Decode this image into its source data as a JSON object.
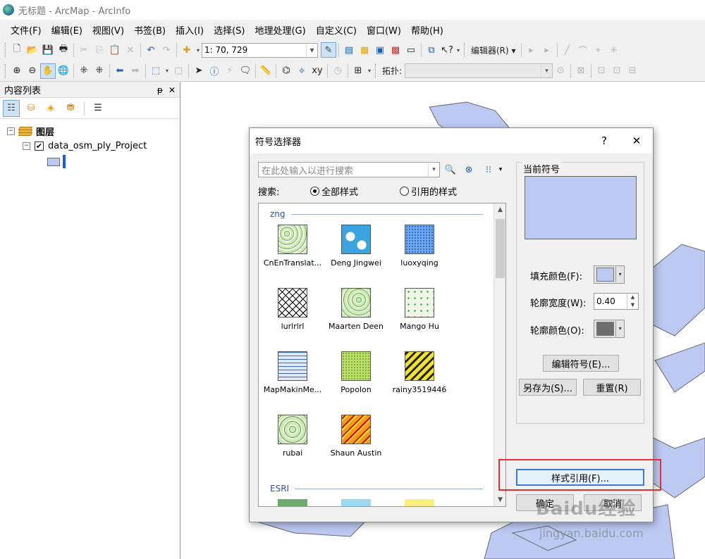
{
  "window": {
    "title": "无标题 - ArcMap - ArcInfo"
  },
  "menu": [
    "文件(F)",
    "编辑(E)",
    "视图(V)",
    "书签(B)",
    "插入(I)",
    "选择(S)",
    "地理处理(G)",
    "自定义(C)",
    "窗口(W)",
    "帮助(H)"
  ],
  "toolbar": {
    "scale": "1: 70, 729",
    "editor_label": "编辑器(R) ▾",
    "topology_label": "拓扑:"
  },
  "toc": {
    "title": "内容列表",
    "pin": "ᵽ",
    "close": "✕",
    "root_label": "图层",
    "layer_label": "data_osm_ply_Project",
    "layer_checked": "✔",
    "layer_fill_color": "#bcc9f2"
  },
  "dialog": {
    "title": "符号选择器",
    "help": "?",
    "close": "✕",
    "search_placeholder": "在此处输入以进行搜索",
    "search_label": "搜索:",
    "radio_all": "全部样式",
    "radio_ref": "引用的样式",
    "groups": [
      {
        "name": "zng",
        "symbols": [
          {
            "label": "CnEnTranslat...",
            "color": "#cfe8b8"
          },
          {
            "label": "Deng Jingwei",
            "color": "#3aa3e0"
          },
          {
            "label": "luoxyqing",
            "color": "#6ea9ec"
          },
          {
            "label": "lurlrlrl",
            "color": "#ffffff"
          },
          {
            "label": "Maarten Deen",
            "color": "#cfe8b8"
          },
          {
            "label": "Mango Hu",
            "color": "#eef7e6"
          },
          {
            "label": "MapMakinMe...",
            "color": "#dfe9fb"
          },
          {
            "label": "Popolon",
            "color": "#b9e06a"
          },
          {
            "label": "rainy3519446",
            "color": "#f3e32a"
          },
          {
            "label": "rubai",
            "color": "#cfe8b8"
          },
          {
            "label": "Shaun Austin",
            "color": "#f59a1c"
          }
        ]
      },
      {
        "name": "ESRI",
        "symbols": [
          {
            "label": "",
            "color": "#6daa6d"
          },
          {
            "label": "",
            "color": "#9ad9f0"
          },
          {
            "label": "",
            "color": "#f7f07a"
          }
        ]
      }
    ],
    "current_symbol_label": "当前符号",
    "fill_color_label": "填充颜色(F):",
    "fill_color": "#bcc9f2",
    "outline_width_label": "轮廓宽度(W):",
    "outline_width": "0.40",
    "outline_color_label": "轮廓颜色(O):",
    "outline_color": "#6e6e6e",
    "edit_symbol_btn": "编辑符号(E)...",
    "save_as_btn": "另存为(S)...",
    "reset_btn": "重置(R)",
    "style_refs_btn": "样式引用(F)...",
    "ok_btn": "确定",
    "cancel_btn": "取消"
  },
  "watermark": {
    "line1": "Baidu经验",
    "line2": "jingyan.baidu.com"
  }
}
